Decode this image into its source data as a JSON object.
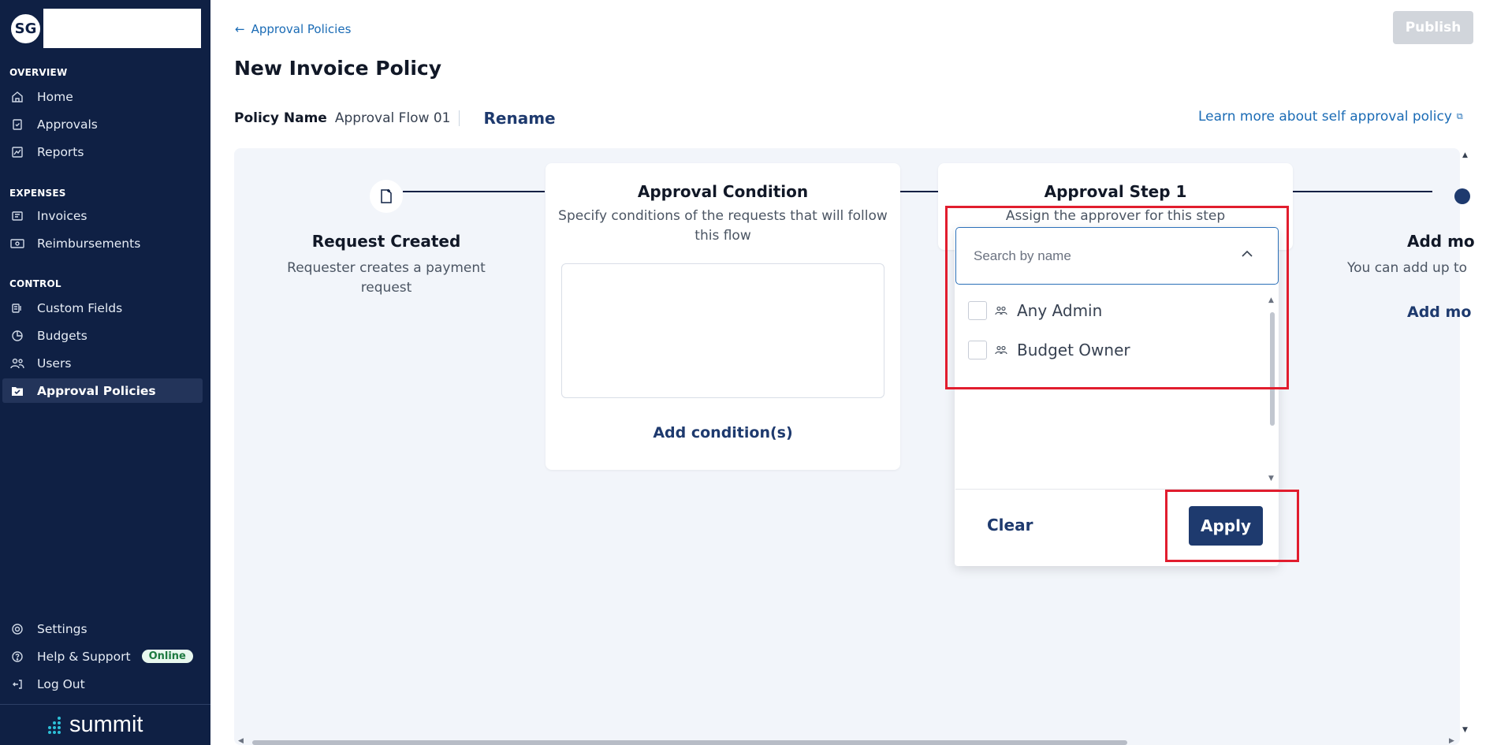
{
  "sidebar": {
    "avatar_initials": "SG",
    "sections": {
      "overview": "OVERVIEW",
      "expenses": "EXPENSES",
      "control": "CONTROL"
    },
    "items": [
      {
        "label": "Home",
        "icon": "home-icon"
      },
      {
        "label": "Approvals",
        "icon": "clipboard-check-icon"
      },
      {
        "label": "Reports",
        "icon": "chart-icon"
      },
      {
        "label": "Invoices",
        "icon": "invoice-icon"
      },
      {
        "label": "Reimbursements",
        "icon": "cash-icon"
      },
      {
        "label": "Custom Fields",
        "icon": "fields-icon"
      },
      {
        "label": "Budgets",
        "icon": "pie-icon"
      },
      {
        "label": "Users",
        "icon": "users-icon"
      },
      {
        "label": "Approval Policies",
        "icon": "policy-icon",
        "active": true
      }
    ],
    "bottom": [
      {
        "label": "Settings",
        "icon": "gear-icon"
      },
      {
        "label": "Help & Support",
        "icon": "help-icon",
        "badge": "Online"
      },
      {
        "label": "Log Out",
        "icon": "logout-icon"
      }
    ],
    "logo_text": "summit"
  },
  "header": {
    "back_label": "Approval Policies",
    "title": "New Invoice Policy",
    "publish_label": "Publish",
    "policy_name_label": "Policy Name",
    "policy_name_value": "Approval Flow 01",
    "rename_label": "Rename",
    "learn_more_label": "Learn more about self approval policy"
  },
  "flow": {
    "request_created": {
      "title": "Request Created",
      "desc_line1": "Requester creates a payment",
      "desc_line2": "request"
    },
    "approval_condition": {
      "title": "Approval Condition",
      "desc_line1": "Specify conditions of the requests that will follow",
      "desc_line2": "this flow",
      "add_label": "Add condition(s)"
    },
    "approval_step": {
      "title": "Approval Step 1",
      "desc": "Assign the approver for this step",
      "search_placeholder": "Search by name",
      "options": [
        {
          "label": "Any Admin",
          "checked": false
        },
        {
          "label": "Budget Owner",
          "checked": false
        }
      ],
      "clear_label": "Clear",
      "apply_label": "Apply"
    },
    "add_more": {
      "title": "Add mo",
      "desc": "You can add up to",
      "link": "Add mo"
    }
  },
  "colors": {
    "sidebar_bg": "#0f2044",
    "primary": "#1e3a6e",
    "link": "#1a6bb5",
    "highlight": "#e11d2e"
  }
}
